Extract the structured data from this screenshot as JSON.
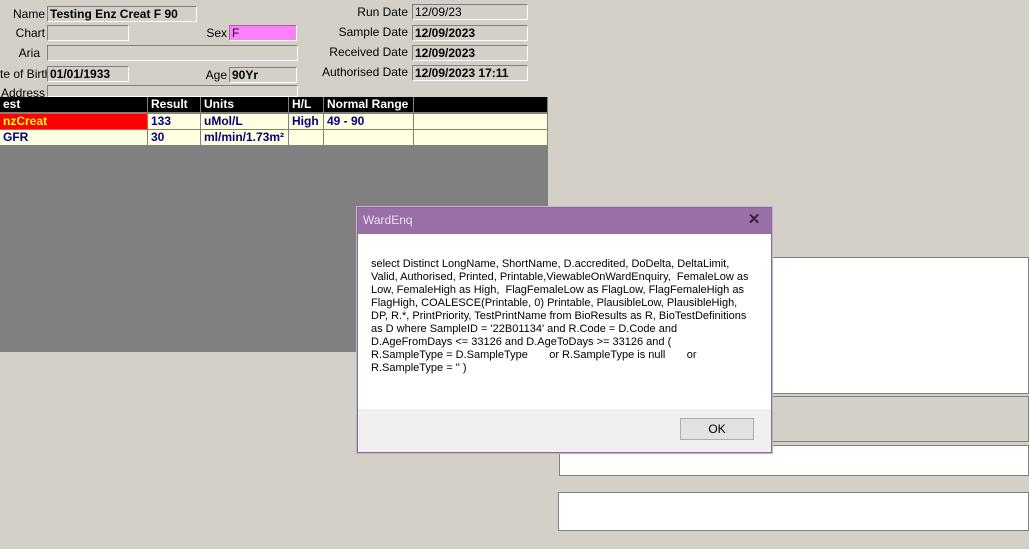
{
  "patient": {
    "name_label": "Name",
    "name_value": "Testing Enz Creat F 90",
    "chart_label": "Chart",
    "chart_value": "",
    "sex_label": "Sex",
    "sex_value": "F",
    "aria_label": "Aria",
    "aria_value": "",
    "dob_label": "te of Birth",
    "dob_value": "01/01/1933",
    "age_label": "Age",
    "age_value": "90Yr",
    "address_label": "Address",
    "address_value": ""
  },
  "dates": {
    "run_label": "Run Date",
    "run_value": "12/09/23",
    "sample_label": "Sample Date",
    "sample_value": "12/09/2023",
    "received_label": "Received Date",
    "received_value": "12/09/2023",
    "authorised_label": "Authorised Date",
    "authorised_value": "12/09/2023 17:11"
  },
  "grid": {
    "headers": [
      "est",
      "Result",
      "Units",
      "H/L",
      "Normal Range",
      ""
    ],
    "rows": [
      [
        "nzCreat",
        "133",
        "uMol/L",
        "High",
        "49 - 90",
        ""
      ],
      [
        "GFR",
        "30",
        "ml/min/1.73m²",
        "",
        "",
        ""
      ]
    ]
  },
  "dialog": {
    "title": "WardEnq",
    "close_glyph": "✕",
    "message": "select Distinct LongName, ShortName, D.accredited, DoDelta, DeltaLimit, Valid, Authorised, Printed, Printable,ViewableOnWardEnquiry,  FemaleLow as Low, FemaleHigh as High,  FlagFemaleLow as FlagLow, FlagFemaleHigh as FlagHigh, COALESCE(Printable, 0) Printable, PlausibleLow, PlausibleHigh, DP, R.*, PrintPriority, TestPrintName from BioResults as R, BioTestDefinitions as D where SampleID = '22B01134' and R.Code = D.Code and D.AgeFromDays <= 33126 and D.AgeToDays >= 33126 and (      R.SampleType = D.SampleType       or R.SampleType is null       or R.SampleType = '' )",
    "ok_label": "OK"
  },
  "colors": {
    "dialog_title": "#9a6fa7",
    "high_flag_bg": "#ff0000",
    "sex_field": "#ff80ff"
  }
}
